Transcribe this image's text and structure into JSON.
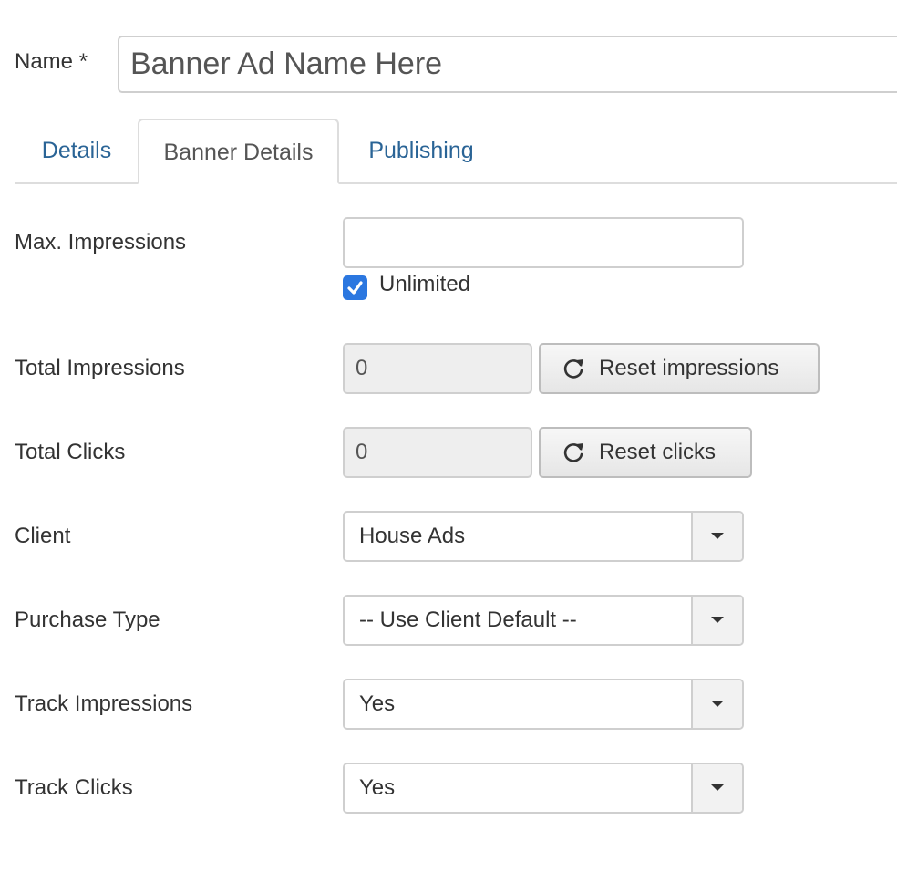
{
  "name_field": {
    "label": "Name *",
    "value": "Banner Ad Name Here"
  },
  "tabs": [
    {
      "label": "Details",
      "active": false
    },
    {
      "label": "Banner Details",
      "active": true
    },
    {
      "label": "Publishing",
      "active": false
    }
  ],
  "form": {
    "max_impressions": {
      "label": "Max. Impressions",
      "value": "",
      "unlimited_label": "Unlimited",
      "unlimited_checked": true
    },
    "total_impressions": {
      "label": "Total Impressions",
      "value": "0",
      "button_label": "Reset impressions",
      "button_icon": "refresh-icon"
    },
    "total_clicks": {
      "label": "Total Clicks",
      "value": "0",
      "button_label": "Reset clicks",
      "button_icon": "refresh-icon"
    },
    "client": {
      "label": "Client",
      "selected": "House Ads"
    },
    "purchase_type": {
      "label": "Purchase Type",
      "selected": "-- Use Client Default --"
    },
    "track_impressions": {
      "label": "Track Impressions",
      "selected": "Yes"
    },
    "track_clicks": {
      "label": "Track Clicks",
      "selected": "Yes"
    }
  },
  "colors": {
    "link": "#2a6496",
    "checkbox": "#2b77e0",
    "border": "#cfcfcf"
  }
}
